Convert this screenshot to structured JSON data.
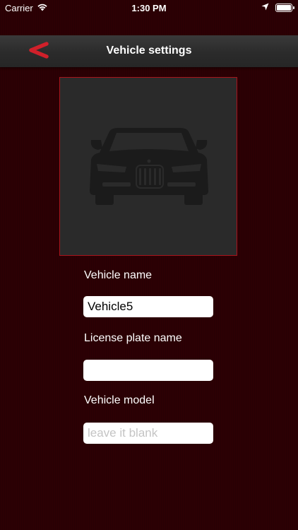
{
  "status_bar": {
    "carrier": "Carrier",
    "time": "1:30 PM"
  },
  "nav": {
    "title": "Vehicle settings",
    "back_icon": "chevron-left-icon",
    "accent_color": "#d0202a"
  },
  "vehicle_image": {
    "icon": "car-front-icon"
  },
  "form": {
    "vehicle_name": {
      "label": "Vehicle name",
      "value": "Vehicle5",
      "placeholder": ""
    },
    "license_plate": {
      "label": "License plate name",
      "value": "",
      "placeholder": ""
    },
    "vehicle_model": {
      "label": "Vehicle model",
      "value": "",
      "placeholder": "leave it blank"
    }
  },
  "colors": {
    "background": "#2c0004",
    "nav_bar": "#2e2e2e",
    "image_frame": "#2a2a2a",
    "frame_border": "#a8141c"
  }
}
